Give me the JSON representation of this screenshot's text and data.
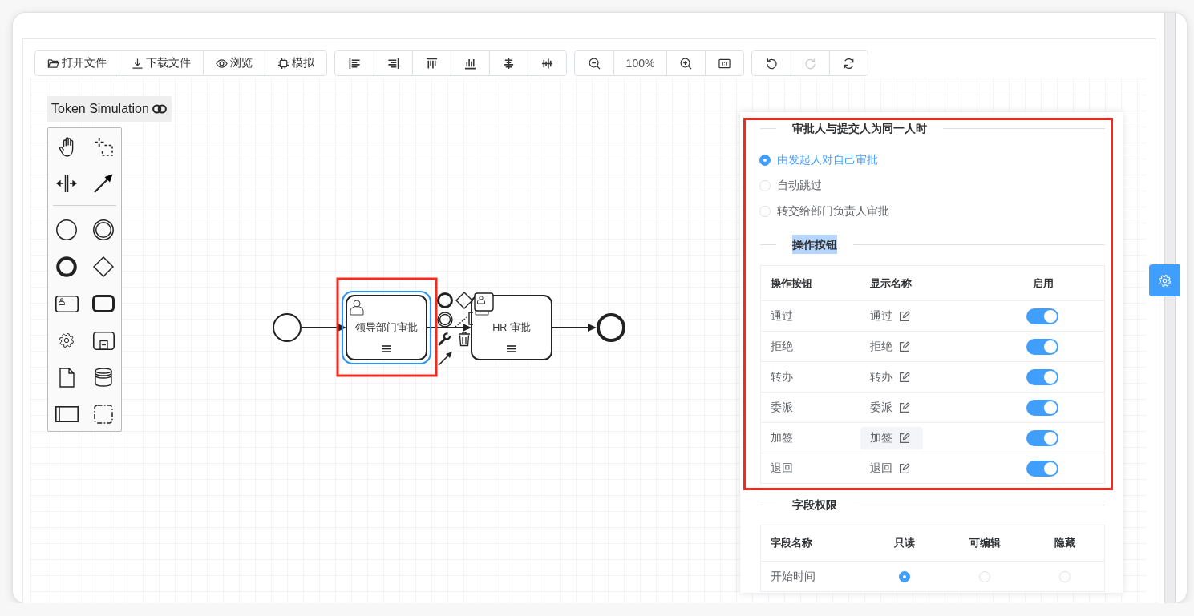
{
  "toolbar": {
    "file_group": [
      {
        "kind": "open",
        "label": "打开文件"
      },
      {
        "kind": "download",
        "label": "下载文件"
      },
      {
        "kind": "preview",
        "label": "浏览"
      },
      {
        "kind": "simulate",
        "label": "模拟"
      }
    ],
    "align_group": [
      {
        "kind": "align-left"
      },
      {
        "kind": "align-right"
      },
      {
        "kind": "align-top"
      },
      {
        "kind": "align-bottom"
      },
      {
        "kind": "align-center"
      },
      {
        "kind": "align-middle"
      }
    ],
    "zoom_group": [
      {
        "kind": "zoom-out"
      },
      {
        "kind": "zoom-level",
        "label": "100%"
      },
      {
        "kind": "zoom-in"
      },
      {
        "kind": "actual-size"
      }
    ],
    "history_group": [
      {
        "kind": "undo",
        "disabled": false
      },
      {
        "kind": "redo",
        "disabled": true
      },
      {
        "kind": "reset",
        "disabled": false
      }
    ]
  },
  "token_simulation": {
    "label": "Token Simulation"
  },
  "diagram": {
    "nodes": [
      {
        "kind": "start-event",
        "selected": false,
        "highlighted": false
      },
      {
        "kind": "user-task",
        "label": "领导部门审批",
        "selected": true,
        "highlighted": true
      },
      {
        "kind": "user-task",
        "label": "HR 审批",
        "selected": false,
        "highlighted": false
      },
      {
        "kind": "end-event",
        "selected": false,
        "highlighted": false
      }
    ]
  },
  "properties_panel": {
    "highlighted": true,
    "approver_section": {
      "title": "审批人与提交人为同一人时",
      "title_selected": false,
      "options": [
        {
          "label": "由发起人对自己审批",
          "selected": true
        },
        {
          "label": "自动跳过",
          "selected": false
        },
        {
          "label": "转交给部门负责人审批",
          "selected": false
        }
      ]
    },
    "buttons_section": {
      "title": "操作按钮",
      "title_selected": true,
      "columns": [
        "操作按钮",
        "显示名称",
        "启用"
      ],
      "rows": [
        {
          "name": "通过",
          "display_name": "通过",
          "hovered": false,
          "enabled": true
        },
        {
          "name": "拒绝",
          "display_name": "拒绝",
          "hovered": false,
          "enabled": true
        },
        {
          "name": "转办",
          "display_name": "转办",
          "hovered": false,
          "enabled": true
        },
        {
          "name": "委派",
          "display_name": "委派",
          "hovered": false,
          "enabled": true
        },
        {
          "name": "加签",
          "display_name": "加签",
          "hovered": true,
          "enabled": true
        },
        {
          "name": "退回",
          "display_name": "退回",
          "hovered": false,
          "enabled": true
        }
      ]
    },
    "fields_section": {
      "title": "字段权限",
      "title_selected": false,
      "columns": [
        "字段名称",
        "只读",
        "可编辑",
        "隐藏"
      ],
      "rows": [
        {
          "name": "开始时间",
          "options": [
            {
              "selected": true
            },
            {
              "selected": false
            },
            {
              "selected": false
            }
          ]
        }
      ]
    }
  }
}
